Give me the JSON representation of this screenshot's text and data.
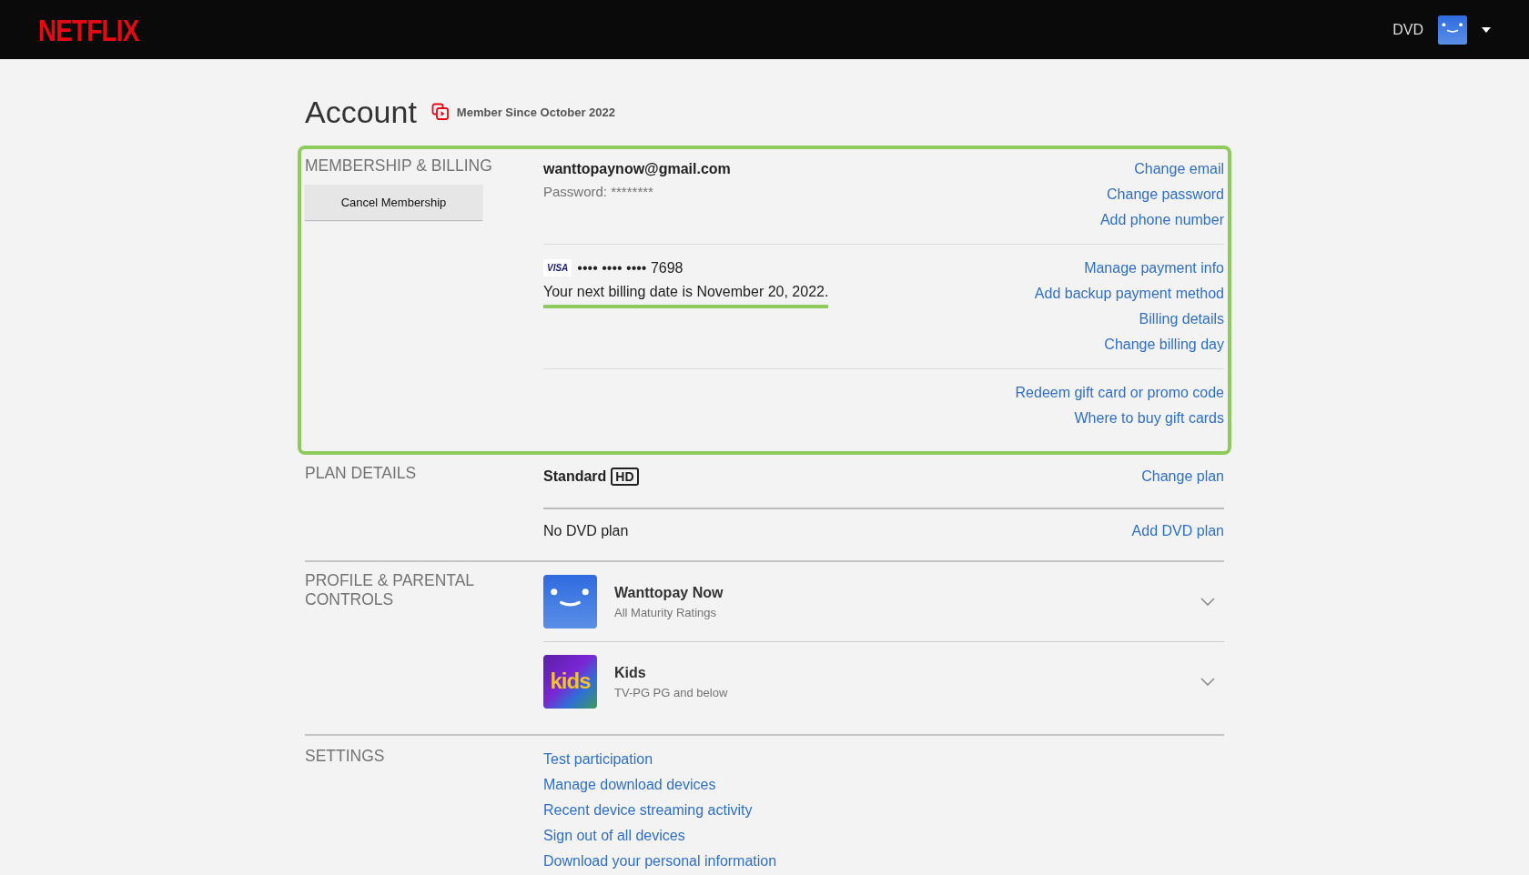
{
  "header": {
    "logo": "NETFLIX",
    "user_label": "DVD",
    "menu_open": false
  },
  "account": {
    "title": "Account",
    "member_since": "Member Since October 2022"
  },
  "sections": [
    {
      "kind": "billing",
      "label": "MEMBERSHIP & BILLING",
      "highlighted": true,
      "button": "Cancel Membership",
      "email": "wanttopaynow@gmail.com",
      "password": "Password: ********",
      "account_links": [
        "Change email",
        "Change password",
        "Add phone number"
      ],
      "card": {
        "brand": "VISA",
        "number": "•••• •••• •••• 7698"
      },
      "billing_note": "Your next billing date is November 20, 2022.",
      "billing_note_underlined": true,
      "payment_links": [
        "Manage payment info",
        "Add backup payment method",
        "Billing details",
        "Change billing day"
      ],
      "gift_links": [
        "Redeem gift card or promo code",
        "Where to buy gift cards"
      ]
    },
    {
      "kind": "plan",
      "label": "PLAN DETAILS",
      "rows": [
        {
          "text": "Standard",
          "badge": "HD",
          "link": "Change plan"
        },
        {
          "text": "No DVD plan",
          "link": "Add DVD plan"
        }
      ]
    },
    {
      "kind": "profiles",
      "label": "PROFILE & PARENTAL CONTROLS",
      "profiles": [
        {
          "kind": "smile",
          "name": "Wanttopay Now",
          "rating": "All Maturity Ratings",
          "expanded": false
        },
        {
          "kind": "kids",
          "avatar_text": "kids",
          "name": "Kids",
          "rating": "TV-PG PG and below",
          "expanded": false
        }
      ]
    },
    {
      "kind": "settings",
      "label": "SETTINGS",
      "links": [
        "Test participation",
        "Manage download devices",
        "Recent device streaming activity",
        "Sign out of all devices",
        "Download your personal information"
      ]
    }
  ]
}
